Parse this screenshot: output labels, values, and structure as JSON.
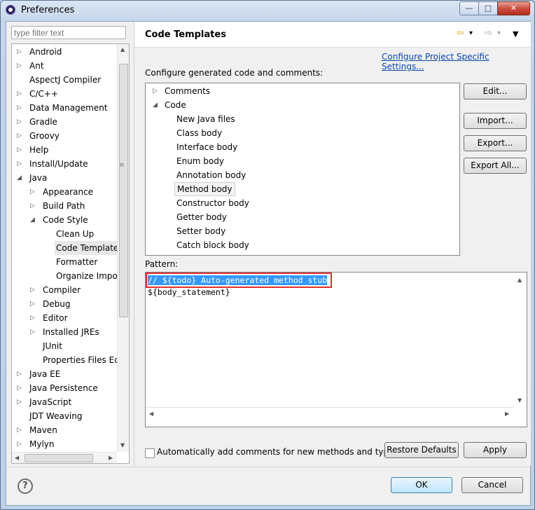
{
  "window": {
    "title": "Preferences",
    "minimize": "—",
    "maximize": "□",
    "close": "✕"
  },
  "filter": {
    "placeholder": "type filter text"
  },
  "tree": [
    {
      "label": "Android",
      "arrow": "▷"
    },
    {
      "label": "Ant",
      "arrow": "▷"
    },
    {
      "label": "AspectJ Compiler",
      "arrow": ""
    },
    {
      "label": "C/C++",
      "arrow": "▷"
    },
    {
      "label": "Data Management",
      "arrow": "▷"
    },
    {
      "label": "Gradle",
      "arrow": "▷"
    },
    {
      "label": "Groovy",
      "arrow": "▷"
    },
    {
      "label": "Help",
      "arrow": "▷"
    },
    {
      "label": "Install/Update",
      "arrow": "▷"
    },
    {
      "label": "Java",
      "arrow": "◢"
    },
    {
      "label": "Appearance",
      "arrow": "▷"
    },
    {
      "label": "Build Path",
      "arrow": "▷"
    },
    {
      "label": "Code Style",
      "arrow": "◢"
    },
    {
      "label": "Clean Up",
      "arrow": ""
    },
    {
      "label": "Code Template",
      "arrow": "",
      "selected": true
    },
    {
      "label": "Formatter",
      "arrow": ""
    },
    {
      "label": "Organize Impo",
      "arrow": ""
    },
    {
      "label": "Compiler",
      "arrow": "▷"
    },
    {
      "label": "Debug",
      "arrow": "▷"
    },
    {
      "label": "Editor",
      "arrow": "▷"
    },
    {
      "label": "Installed JREs",
      "arrow": "▷"
    },
    {
      "label": "JUnit",
      "arrow": ""
    },
    {
      "label": "Properties Files Ed",
      "arrow": ""
    },
    {
      "label": "Java EE",
      "arrow": "▷"
    },
    {
      "label": "Java Persistence",
      "arrow": "▷"
    },
    {
      "label": "JavaScript",
      "arrow": "▷"
    },
    {
      "label": "JDT Weaving",
      "arrow": ""
    },
    {
      "label": "Maven",
      "arrow": "▷"
    },
    {
      "label": "Mylyn",
      "arrow": "▷"
    }
  ],
  "page": {
    "title": "Code Templates",
    "configure_link": "Configure Project Specific Settings...",
    "configure_label": "Configure generated code and comments:",
    "pattern_label": "Pattern:",
    "checkbox_label": "Automatically add comments for new methods and types"
  },
  "templates": [
    {
      "label": "Comments",
      "arrow": "▷"
    },
    {
      "label": "Code",
      "arrow": "◢"
    },
    {
      "label": "New Java files",
      "arrow": ""
    },
    {
      "label": "Class body",
      "arrow": ""
    },
    {
      "label": "Interface body",
      "arrow": ""
    },
    {
      "label": "Enum body",
      "arrow": ""
    },
    {
      "label": "Annotation body",
      "arrow": ""
    },
    {
      "label": "Method body",
      "arrow": "",
      "selected": true
    },
    {
      "label": "Constructor body",
      "arrow": ""
    },
    {
      "label": "Getter body",
      "arrow": ""
    },
    {
      "label": "Setter body",
      "arrow": ""
    },
    {
      "label": "Catch block body",
      "arrow": ""
    }
  ],
  "pattern_lines": [
    "// ${todo} Auto-generated method stub",
    "${body_statement}"
  ],
  "buttons": {
    "edit": "Edit...",
    "import": "Import...",
    "export": "Export...",
    "export_all": "Export All...",
    "restore": "Restore Defaults",
    "apply": "Apply",
    "ok": "OK",
    "cancel": "Cancel"
  },
  "nav_icons": {
    "back": "⇦",
    "forward": "⇨",
    "dropdown": "▾",
    "menu": "▼"
  },
  "help_glyph": "?",
  "scroll_arrows": {
    "up": "▲",
    "down": "▼",
    "left": "◀",
    "right": "▶",
    "grip": "≡"
  }
}
